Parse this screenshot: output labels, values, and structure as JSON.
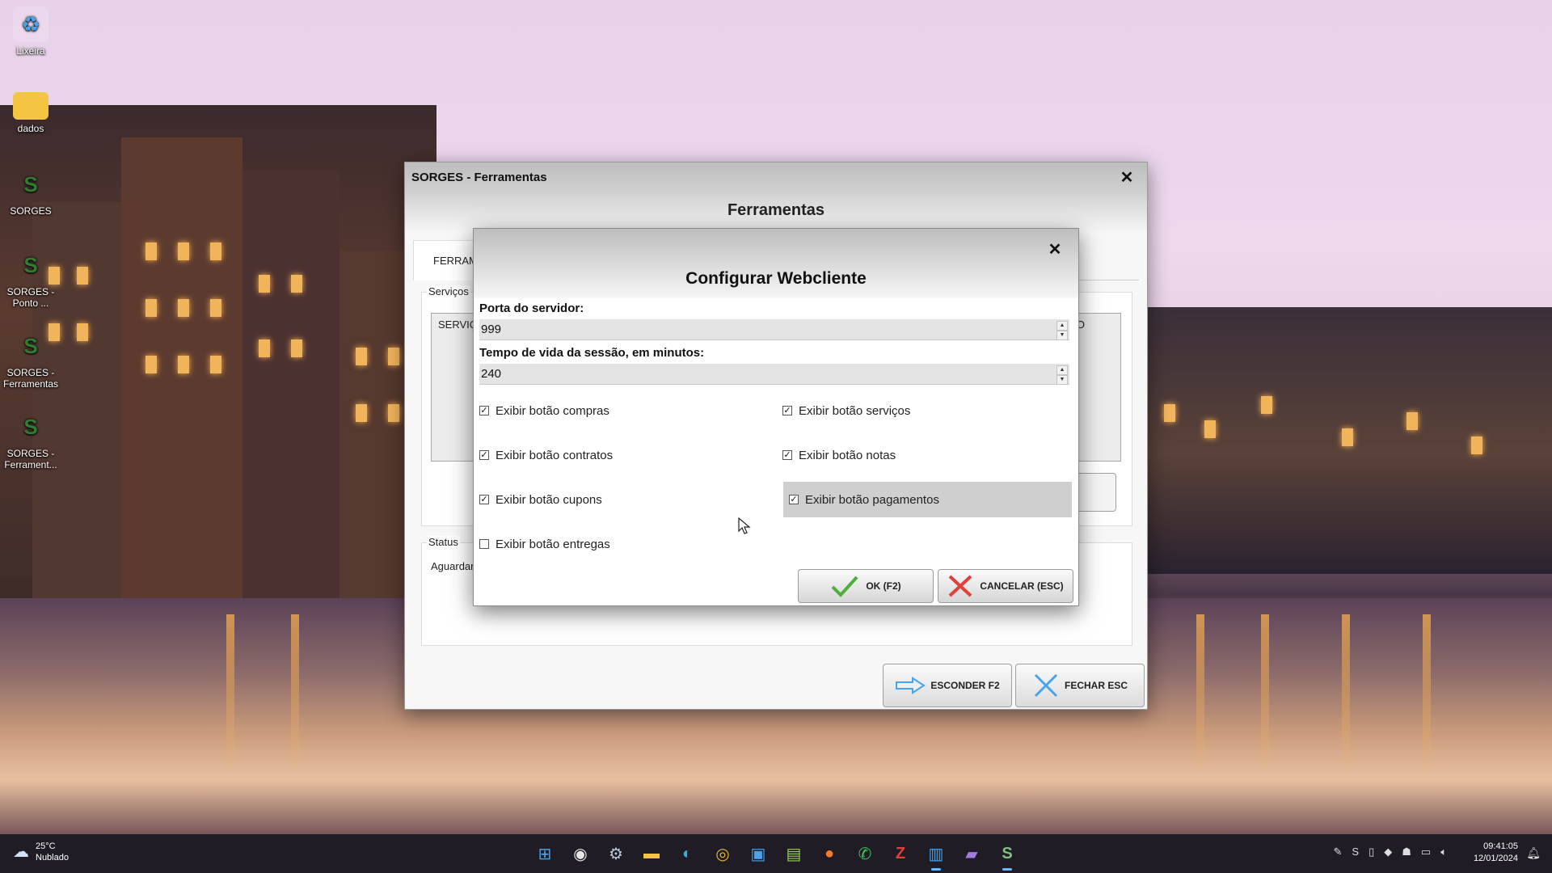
{
  "desktop": {
    "icons": [
      {
        "label": "Lixeira",
        "icon": "recycle-bin-icon"
      },
      {
        "label": "dados",
        "icon": "folder-icon"
      },
      {
        "label": "SORGES",
        "icon": "sorges-app-icon"
      },
      {
        "label": "SORGES - Ponto ...",
        "icon": "sorges-app-icon"
      },
      {
        "label": "SORGES - Ferramentas",
        "icon": "sorges-app-icon"
      },
      {
        "label": "SORGES - Ferrament...",
        "icon": "sorges-app-icon"
      }
    ]
  },
  "main_window": {
    "title": "SORGES - Ferramentas",
    "header": "Ferramentas",
    "tab_label": "FERRAM",
    "services_group_label": "Serviços",
    "services_list_header": "SERVIÇ",
    "services_list_header_right": "O",
    "status_group_label": "Status",
    "status_text": "Aguardar",
    "hide_button": "ESCONDER F2",
    "close_button": "FECHAR ESC"
  },
  "dialog": {
    "title": "Configurar Webcliente",
    "port_label": "Porta do servidor:",
    "port_value": "999",
    "session_label": "Tempo de vida da sessão, em minutos:",
    "session_value": "240",
    "checkboxes": [
      {
        "label": "Exibir botão compras",
        "checked": true
      },
      {
        "label": "Exibir botão serviços",
        "checked": true
      },
      {
        "label": "Exibir botão contratos",
        "checked": true
      },
      {
        "label": "Exibir botão notas",
        "checked": true
      },
      {
        "label": "Exibir botão cupons",
        "checked": true
      },
      {
        "label": "Exibir botão pagamentos",
        "checked": true,
        "highlighted": true
      },
      {
        "label": "Exibir botão entregas",
        "checked": false
      }
    ],
    "ok_button": "OK (F2)",
    "cancel_button": "CANCELAR (ESC)"
  },
  "taskbar": {
    "weather_temp": "25°C",
    "weather_desc": "Nublado",
    "time": "09:41:05",
    "date": "12/01/2024",
    "apps": [
      "start-icon",
      "steam-icon",
      "settings-icon",
      "file-explorer-icon",
      "edge-icon",
      "chrome-icon",
      "remote-desktop-icon",
      "notepad-plus-icon",
      "firefox-icon",
      "whatsapp-icon",
      "filezilla-icon",
      "notepad-icon",
      "media-player-icon",
      "sorges-app-icon"
    ]
  },
  "colors": {
    "taskbar": "#1f1c26",
    "dialog_header_top": "#bdbdbd",
    "checkbox_highlight": "#cfcfcf",
    "ok_check": "#4caf3c",
    "cancel_x": "#e0403a",
    "close_x": "#4aa3e8",
    "accent": "#6cb8ff"
  }
}
